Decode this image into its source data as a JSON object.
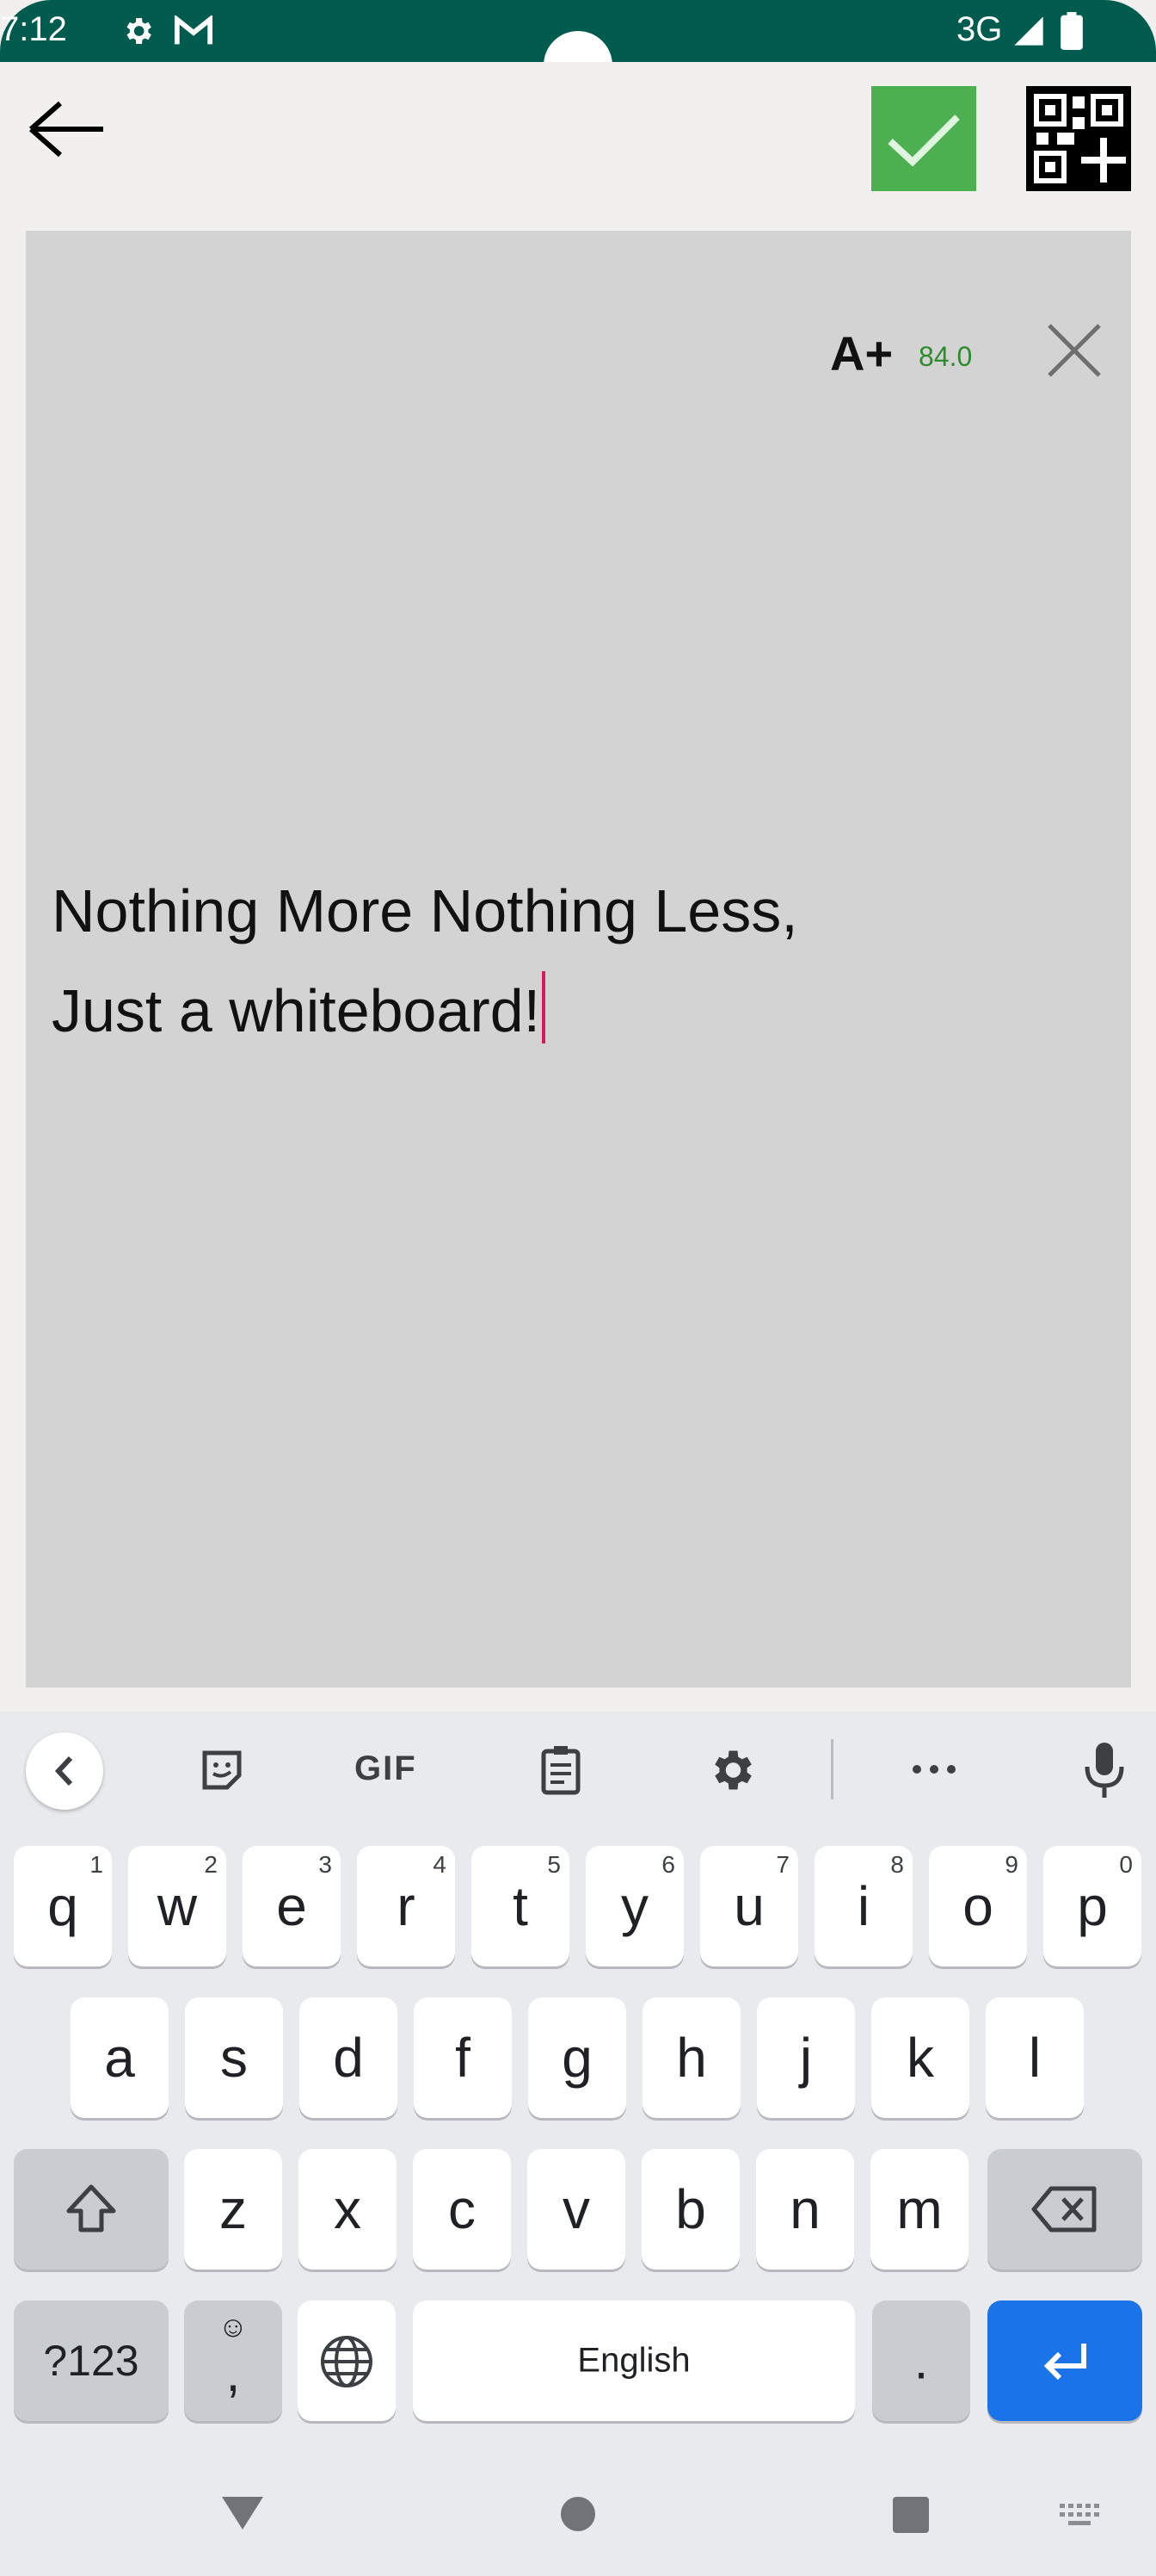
{
  "status_bar": {
    "time": "7:12",
    "network": "3G",
    "icons": [
      "gear-icon",
      "gmail-icon",
      "signal-icon",
      "battery-icon"
    ]
  },
  "app_bar": {
    "icons": [
      "back-arrow-icon",
      "check-icon",
      "qr-add-icon"
    ],
    "confirm_color": "#4caf50"
  },
  "board": {
    "font_button_label": "A+",
    "font_size": "84.0",
    "lines": [
      "Nothing More Nothing Less,",
      "Just a whiteboard!"
    ],
    "background": "#d3d3d3"
  },
  "keyboard": {
    "toolbar_icons": [
      "chevron-left-icon",
      "sticker-icon",
      "gif-icon",
      "clipboard-icon",
      "settings-icon",
      "more-icon",
      "mic-icon"
    ],
    "gif_label": "GIF",
    "row1": [
      {
        "key": "q",
        "hint": "1"
      },
      {
        "key": "w",
        "hint": "2"
      },
      {
        "key": "e",
        "hint": "3"
      },
      {
        "key": "r",
        "hint": "4"
      },
      {
        "key": "t",
        "hint": "5"
      },
      {
        "key": "y",
        "hint": "6"
      },
      {
        "key": "u",
        "hint": "7"
      },
      {
        "key": "i",
        "hint": "8"
      },
      {
        "key": "o",
        "hint": "9"
      },
      {
        "key": "p",
        "hint": "0"
      }
    ],
    "row2": [
      "a",
      "s",
      "d",
      "f",
      "g",
      "h",
      "j",
      "k",
      "l"
    ],
    "row3": [
      "z",
      "x",
      "c",
      "v",
      "b",
      "n",
      "m"
    ],
    "symbols_label": "?123",
    "comma_label": ",",
    "emoji_hint": "☺",
    "space_label": "English",
    "period_label": "."
  }
}
